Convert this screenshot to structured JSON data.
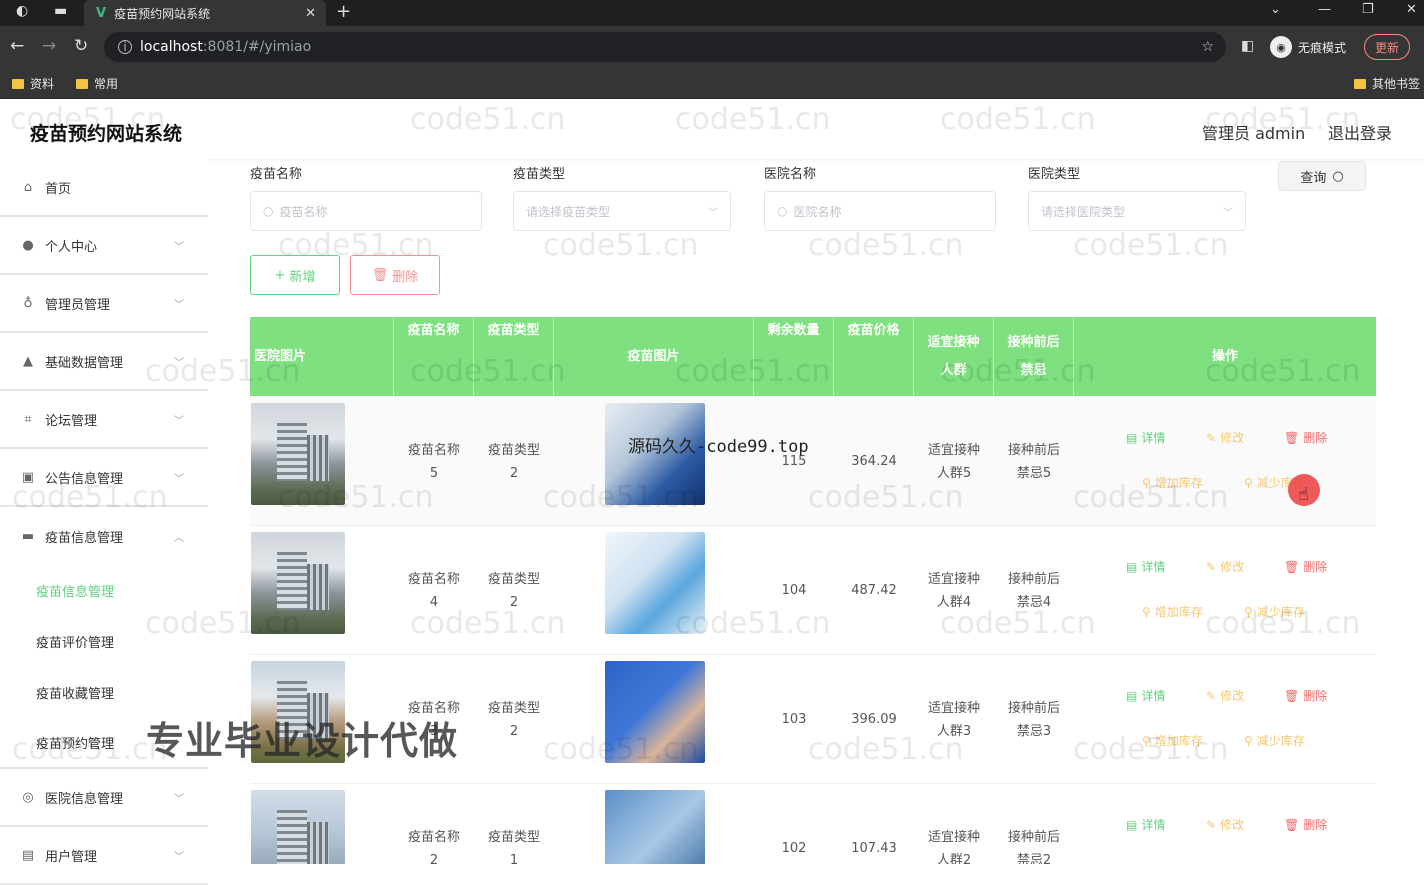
{
  "browser": {
    "tab_title": "疫苗预约网站系统",
    "tab_logo": "V",
    "url_host": "localhost",
    "url_rest": ":8081/#/yimiao",
    "incognito_label": "无痕模式",
    "update_label": "更新",
    "bookmarks": [
      "资料",
      "常用"
    ],
    "other_bookmarks": "其他书签"
  },
  "app": {
    "title": "疫苗预约网站系统",
    "admin_label": "管理员 admin",
    "logout_label": "退出登录"
  },
  "sidebar": {
    "items": [
      {
        "label": "首页",
        "icon": "home-icon"
      },
      {
        "label": "个人中心",
        "icon": "user-icon"
      },
      {
        "label": "管理员管理",
        "icon": "mic-icon"
      },
      {
        "label": "基础数据管理",
        "icon": "person-icon"
      },
      {
        "label": "论坛管理",
        "icon": "crop-icon"
      },
      {
        "label": "公告信息管理",
        "icon": "chart-icon"
      },
      {
        "label": "疫苗信息管理",
        "icon": "monitor-icon"
      }
    ],
    "sub_items": [
      "疫苗信息管理",
      "疫苗评价管理",
      "疫苗收藏管理",
      "疫苗预约管理"
    ],
    "bottom_items": [
      {
        "label": "医院信息管理",
        "icon": "globe-icon"
      },
      {
        "label": "用户管理",
        "icon": "users-icon"
      }
    ]
  },
  "filters": {
    "vaccine_name_label": "疫苗名称",
    "vaccine_name_placeholder": "疫苗名称",
    "vaccine_type_label": "疫苗类型",
    "vaccine_type_placeholder": "请选择疫苗类型",
    "hospital_name_label": "医院名称",
    "hospital_name_placeholder": "医院名称",
    "hospital_type_label": "医院类型",
    "hospital_type_placeholder": "请选择医院类型",
    "query_label": "查询"
  },
  "toolbar": {
    "add_label": "新增",
    "delete_label": "删除"
  },
  "table": {
    "headers": {
      "hospital_image": "医院图片",
      "vaccine_name": "疫苗名称",
      "vaccine_type": "疫苗类型",
      "vaccine_image": "疫苗图片",
      "stock": "剩余数量",
      "price": "疫苗价格",
      "suitable_line1": "适宜接种",
      "suitable_line2": "人群",
      "taboo_line1": "接种前后",
      "taboo_line2": "禁忌",
      "actions": "操作"
    },
    "actions": {
      "detail": "详情",
      "edit": "修改",
      "delete": "删除",
      "add_stock": "增加库存",
      "reduce_stock": "减少库存"
    },
    "rows": [
      {
        "name_line1": "疫苗名称",
        "name_line2": "5",
        "type_line1": "疫苗类型",
        "type_line2": "2",
        "stock": "115",
        "price": "364.24",
        "suit_line1": "适宜接种",
        "suit_line2": "人群5",
        "taboo_line1": "接种前后",
        "taboo_line2": "禁忌5"
      },
      {
        "name_line1": "疫苗名称",
        "name_line2": "4",
        "type_line1": "疫苗类型",
        "type_line2": "2",
        "stock": "104",
        "price": "487.42",
        "suit_line1": "适宜接种",
        "suit_line2": "人群4",
        "taboo_line1": "接种前后",
        "taboo_line2": "禁忌4"
      },
      {
        "name_line1": "疫苗名称",
        "name_line2": "3",
        "type_line1": "疫苗类型",
        "type_line2": "2",
        "stock": "103",
        "price": "396.09",
        "suit_line1": "适宜接种",
        "suit_line2": "人群3",
        "taboo_line1": "接种前后",
        "taboo_line2": "禁忌3"
      },
      {
        "name_line1": "疫苗名称",
        "name_line2": "2",
        "type_line1": "疫苗类型",
        "type_line2": "1",
        "stock": "102",
        "price": "107.43",
        "suit_line1": "适宜接种",
        "suit_line2": "人群2",
        "taboo_line1": "接种前后",
        "taboo_line2": "禁忌2"
      }
    ]
  },
  "overlays": {
    "watermark": "code51.cn",
    "mid_watermark": "源码久久-code99.top",
    "big_watermark": "专业毕业设计代做"
  },
  "colors": {
    "accent": "#5fd37e",
    "header_bg": "#7ee07e",
    "danger": "#f56c6c",
    "warning": "#f6c971"
  }
}
